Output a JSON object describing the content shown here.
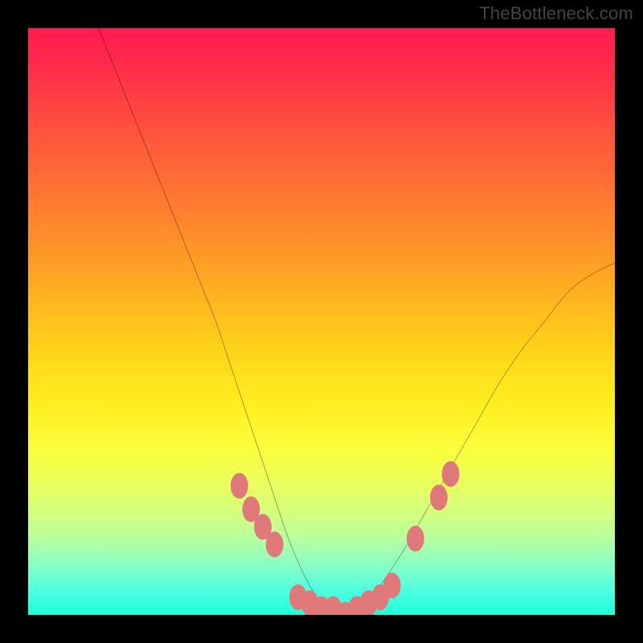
{
  "watermark": "TheBottleneck.com",
  "chart_data": {
    "type": "line",
    "title": "",
    "xlabel": "",
    "ylabel": "",
    "xlim": [
      0,
      100
    ],
    "ylim": [
      0,
      100
    ],
    "grid": false,
    "legend": false,
    "curve": {
      "name": "bottleneck-curve",
      "x": [
        12,
        16,
        20,
        24,
        28,
        30,
        32,
        34,
        36,
        38,
        40,
        42,
        44,
        46,
        48,
        50,
        52,
        54,
        56,
        58,
        60,
        64,
        68,
        72,
        76,
        80,
        84,
        88,
        92,
        96,
        100
      ],
      "y": [
        100,
        90,
        80,
        70,
        60,
        55,
        50,
        44,
        38,
        32,
        26,
        20,
        14,
        9,
        5,
        2,
        1,
        0,
        1,
        2,
        5,
        11,
        18,
        25,
        32,
        39,
        45,
        50,
        55,
        58,
        60
      ]
    },
    "markers": {
      "name": "bottleneck-markers",
      "x": [
        36,
        38,
        40,
        42,
        46,
        48,
        50,
        52,
        54,
        56,
        58,
        60,
        62,
        66,
        70,
        72
      ],
      "y": [
        22,
        18,
        15,
        12,
        3,
        2,
        1,
        1,
        0,
        1,
        2,
        3,
        5,
        13,
        20,
        24
      ]
    },
    "gradient_stops": [
      {
        "pos": 0,
        "color": "#ff1a4f"
      },
      {
        "pos": 15,
        "color": "#ff4a3f"
      },
      {
        "pos": 35,
        "color": "#ff8c2b"
      },
      {
        "pos": 55,
        "color": "#ffd41a"
      },
      {
        "pos": 72,
        "color": "#fbff3e"
      },
      {
        "pos": 87,
        "color": "#b7ff9e"
      },
      {
        "pos": 100,
        "color": "#1fffd8"
      }
    ],
    "marker_color": "#e07a7a",
    "curve_color": "#000000"
  }
}
